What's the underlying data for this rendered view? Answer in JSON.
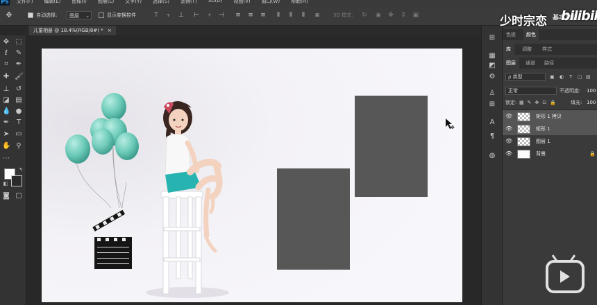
{
  "app": {
    "logo": "PS"
  },
  "menu": [
    "文件(F)",
    "编辑(E)",
    "图像(I)",
    "图层(L)",
    "文字(Y)",
    "选择(S)",
    "滤镜(T)",
    "3D(D)",
    "视图(V)",
    "窗口(W)",
    "帮助(H)"
  ],
  "options": {
    "auto_select_label": "自动选择:",
    "auto_select_value": "图层",
    "show_transform_label": "显示变换控件",
    "mode_3d_label": "3D 模式:"
  },
  "document_tab": {
    "title": "儿童相册 @ 18.4%(RGB/8#) *",
    "close": "×"
  },
  "panels": {
    "row1_tabs": [
      "色板",
      "颜色"
    ],
    "row2_tabs": [
      "库",
      "调整",
      "样式"
    ],
    "row3_tabs": [
      "图层",
      "通道",
      "路径"
    ],
    "filter_kind": "ρ 类型",
    "blend_mode": "正常",
    "opacity_label": "不透明度:",
    "opacity_value": "100",
    "lock_label": "锁定:",
    "fill_label": "填充:",
    "fill_value": "100"
  },
  "layers": [
    {
      "name": "矩形 1 拷贝",
      "selected": true
    },
    {
      "name": "矩形 1",
      "selected": true
    },
    {
      "name": "图层 1",
      "selected": false
    },
    {
      "name": "背景",
      "selected": false
    }
  ],
  "watermark": {
    "channel": "少时宗恋",
    "brand": "bilibili",
    "sub": "基本功能"
  },
  "colors": {
    "shape_fill": "#575757",
    "canvas_bg": "#f6f5f9",
    "balloon": "#6ccab8"
  }
}
